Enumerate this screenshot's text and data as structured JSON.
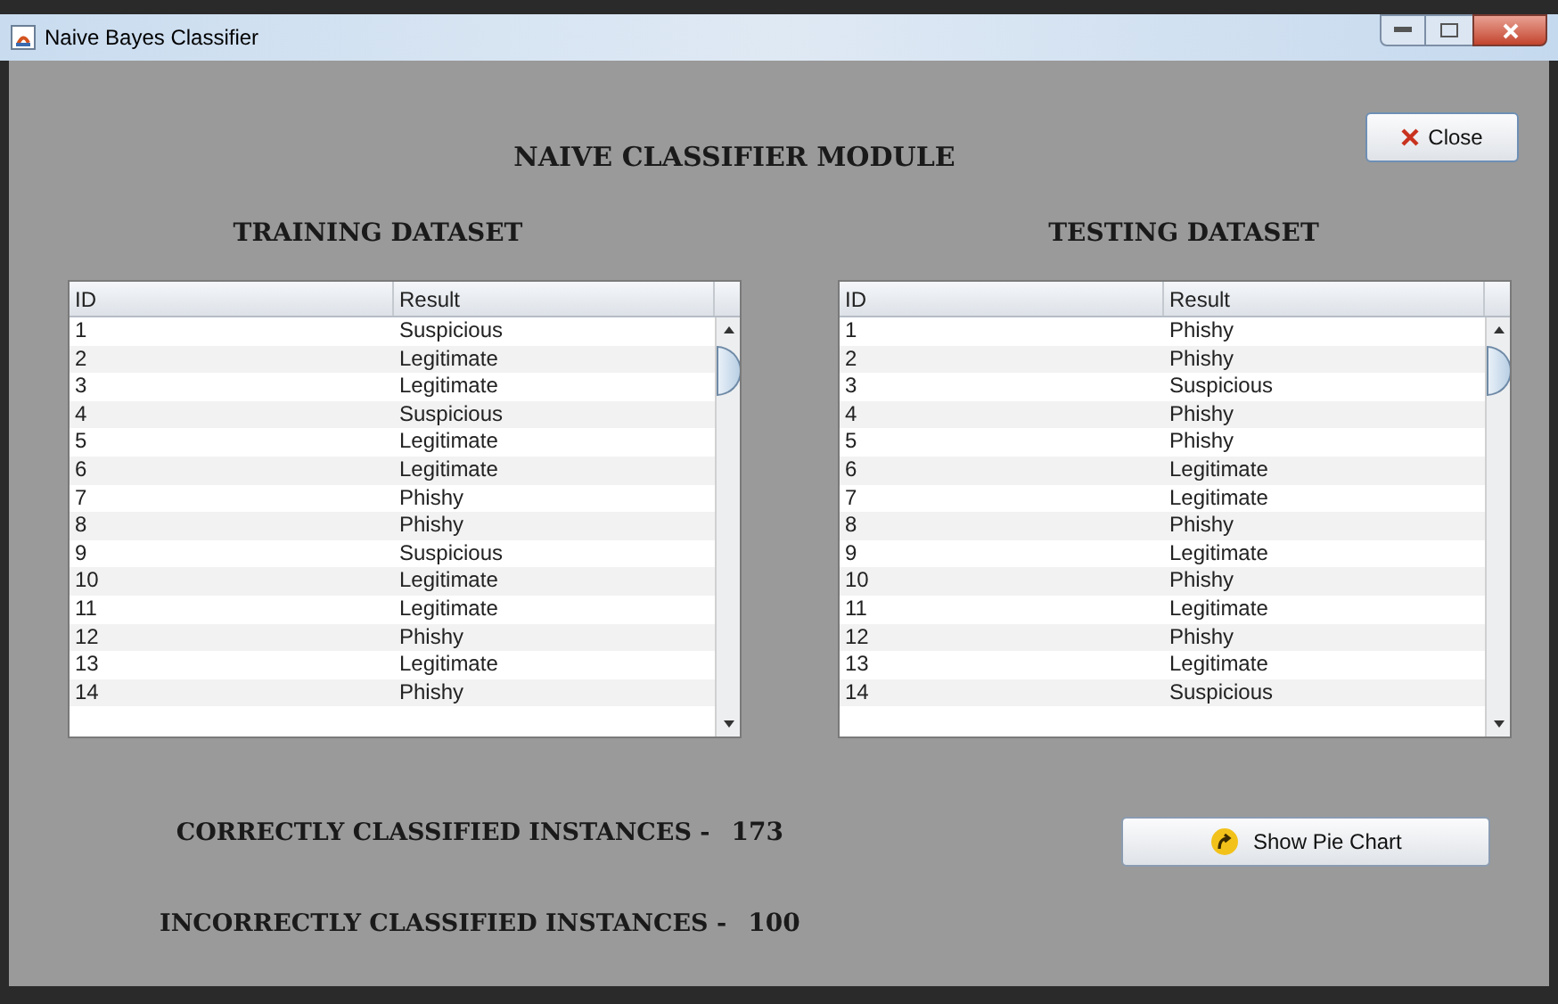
{
  "window": {
    "title": "Naive Bayes Classifier"
  },
  "heading": "NAIVE CLASSIFIER MODULE",
  "close_button": "Close",
  "tables": [
    {
      "title": "TRAINING DATASET",
      "columns": [
        "ID",
        "Result"
      ],
      "rows": [
        [
          "1",
          "Suspicious"
        ],
        [
          "2",
          "Legitimate"
        ],
        [
          "3",
          "Legitimate"
        ],
        [
          "4",
          "Suspicious"
        ],
        [
          "5",
          "Legitimate"
        ],
        [
          "6",
          "Legitimate"
        ],
        [
          "7",
          "Phishy"
        ],
        [
          "8",
          "Phishy"
        ],
        [
          "9",
          "Suspicious"
        ],
        [
          "10",
          "Legitimate"
        ],
        [
          "11",
          "Legitimate"
        ],
        [
          "12",
          "Phishy"
        ],
        [
          "13",
          "Legitimate"
        ],
        [
          "14",
          "Phishy"
        ]
      ]
    },
    {
      "title": "TESTING DATASET",
      "columns": [
        "ID",
        "Result"
      ],
      "rows": [
        [
          "1",
          "Phishy"
        ],
        [
          "2",
          "Phishy"
        ],
        [
          "3",
          "Suspicious"
        ],
        [
          "4",
          "Phishy"
        ],
        [
          "5",
          "Phishy"
        ],
        [
          "6",
          "Legitimate"
        ],
        [
          "7",
          "Legitimate"
        ],
        [
          "8",
          "Phishy"
        ],
        [
          "9",
          "Legitimate"
        ],
        [
          "10",
          "Phishy"
        ],
        [
          "11",
          "Legitimate"
        ],
        [
          "12",
          "Phishy"
        ],
        [
          "13",
          "Legitimate"
        ],
        [
          "14",
          "Suspicious"
        ]
      ]
    }
  ],
  "stats": [
    {
      "label": "CORRECTLY CLASSIFIED INSTANCES -",
      "value": "173"
    },
    {
      "label": "INCORRECTLY CLASSIFIED INSTANCES -",
      "value": "100"
    }
  ],
  "pie_button": "Show Pie Chart"
}
